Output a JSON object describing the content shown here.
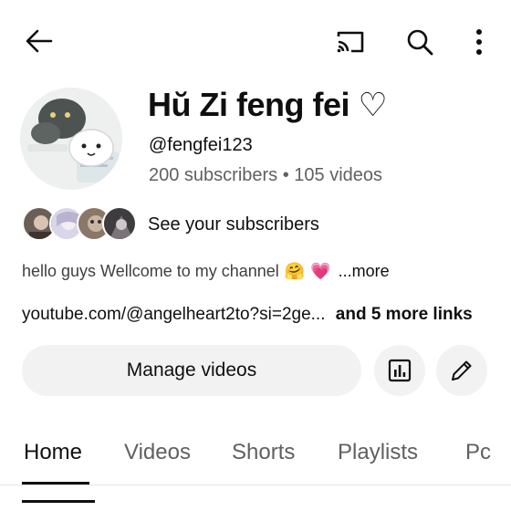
{
  "topbar": {
    "back_icon": "arrow-left-icon",
    "cast_icon": "cast-icon",
    "search_icon": "search-icon",
    "more_icon": "more-vert-icon"
  },
  "channel": {
    "name": "Hŭ Zi feng fei ♡",
    "handle": "@fengfei123",
    "stats": "200 subscribers • 105 videos"
  },
  "subscribers": {
    "label": "See your subscribers"
  },
  "description": {
    "text": "hello guys Wellcome to my channel",
    "emojis": [
      "🤗",
      "💗"
    ],
    "more_label": "...more"
  },
  "links": {
    "url": "youtube.com/@angelheart2to?si=2ge...",
    "more_links": "and 5 more links"
  },
  "actions": {
    "manage_label": "Manage videos",
    "analytics_icon": "analytics-icon",
    "edit_icon": "edit-pencil-icon"
  },
  "tabs": [
    {
      "label": "Home",
      "active": true
    },
    {
      "label": "Videos",
      "active": false
    },
    {
      "label": "Shorts",
      "active": false
    },
    {
      "label": "Playlists",
      "active": false
    },
    {
      "label": "Pc",
      "active": false
    }
  ]
}
